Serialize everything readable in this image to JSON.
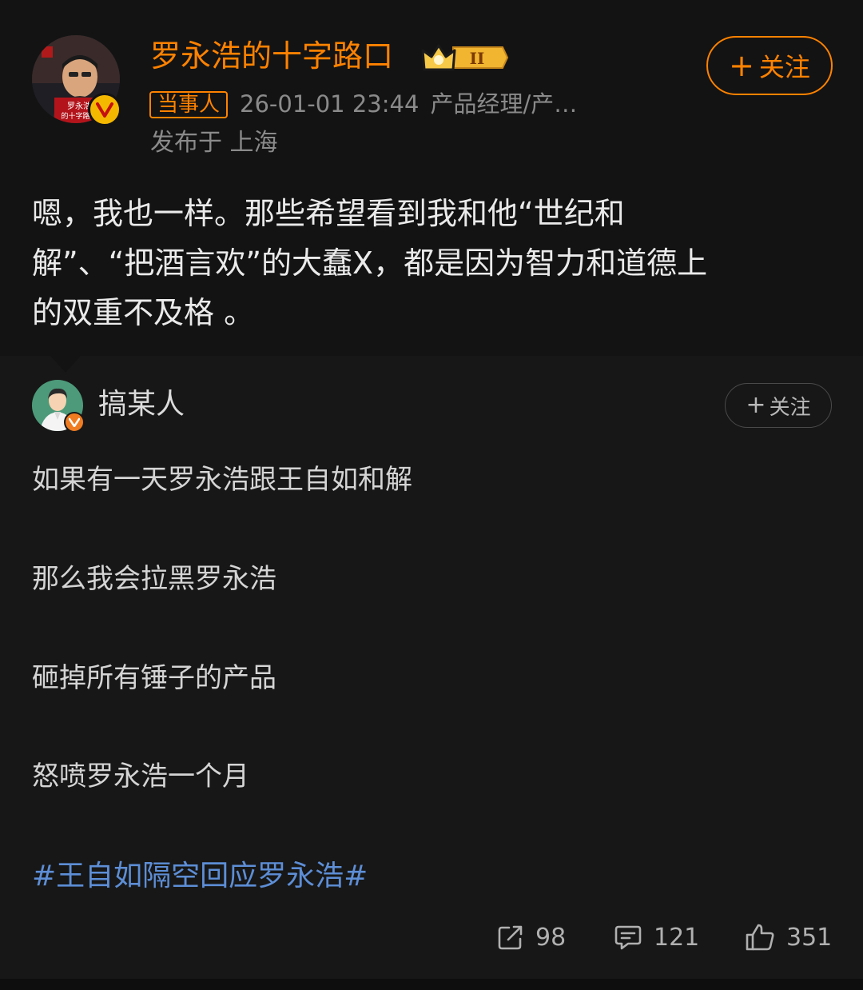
{
  "post": {
    "author": {
      "name": "罗永浩的十字路口",
      "avatar_caption": "罗永浩 的十字路口",
      "verified_icon": "verified-v-icon",
      "crown_badge_icon": "crown-level-badge-icon",
      "crown_badge_level": "II"
    },
    "follow_label": "关注",
    "tag_label": "当事人",
    "timestamp": "26-01-01 23:44",
    "occupation": "产品经理/产…",
    "location": "发布于 上海",
    "text_lines": [
      "嗯，我也一样。那些希望看到我和他“世纪和",
      "解”、“把酒言欢”的大蠢X，都是因为智力和道德上",
      "的双重不及格 。"
    ]
  },
  "quoted": {
    "author": {
      "name": "搞某人",
      "verified_icon": "verified-v-icon"
    },
    "follow_label": "关注",
    "lines": [
      "如果有一天罗永浩跟王自如和解",
      "那么我会拉黑罗永浩",
      "砸掉所有锤子的产品",
      "怒喷罗永浩一个月"
    ],
    "hashtag": "#王自如隔空回应罗永浩#"
  },
  "actions": {
    "repost": {
      "icon": "share-icon",
      "count": "98"
    },
    "comment": {
      "icon": "comment-icon",
      "count": "121"
    },
    "like": {
      "icon": "thumbs-up-icon",
      "count": "351"
    }
  },
  "colors": {
    "accent": "#ff8200",
    "hashtag": "#5d8ed6",
    "background": "#171717",
    "top_background": "#131313"
  }
}
